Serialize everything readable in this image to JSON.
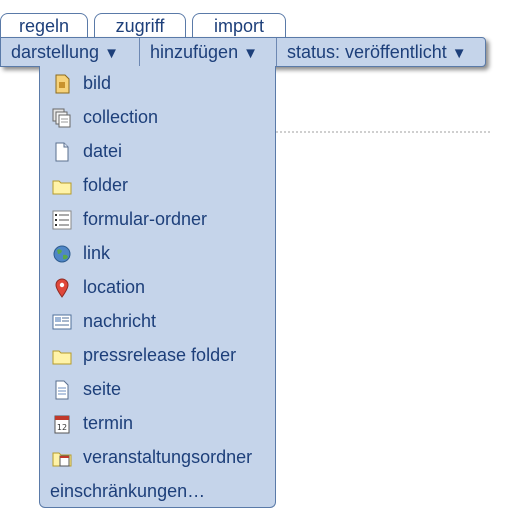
{
  "tabs": [
    {
      "label": "regeln"
    },
    {
      "label": "zugriff"
    },
    {
      "label": "import"
    }
  ],
  "toolbar": {
    "items": [
      {
        "label": "darstellung"
      },
      {
        "label": "hinzufügen"
      },
      {
        "label": "status: veröffentlicht"
      }
    ],
    "caret": "▼"
  },
  "menu": {
    "items": [
      {
        "label": "bild",
        "icon": "image-icon"
      },
      {
        "label": "collection",
        "icon": "collection-icon"
      },
      {
        "label": "datei",
        "icon": "file-icon"
      },
      {
        "label": "folder",
        "icon": "folder-icon"
      },
      {
        "label": "formular-ordner",
        "icon": "form-folder-icon"
      },
      {
        "label": "link",
        "icon": "globe-icon"
      },
      {
        "label": "location",
        "icon": "map-pin-icon"
      },
      {
        "label": "nachricht",
        "icon": "news-icon"
      },
      {
        "label": "pressrelease folder",
        "icon": "folder-icon"
      },
      {
        "label": "seite",
        "icon": "page-icon"
      },
      {
        "label": "termin",
        "icon": "calendar-icon"
      },
      {
        "label": "veranstaltungsordner",
        "icon": "event-folder-icon"
      }
    ],
    "footer_label": "einschränkungen…"
  },
  "colors": {
    "bar_background": "#c5d4ea",
    "text": "#1d3f7a",
    "border": "#5a7aa8"
  }
}
